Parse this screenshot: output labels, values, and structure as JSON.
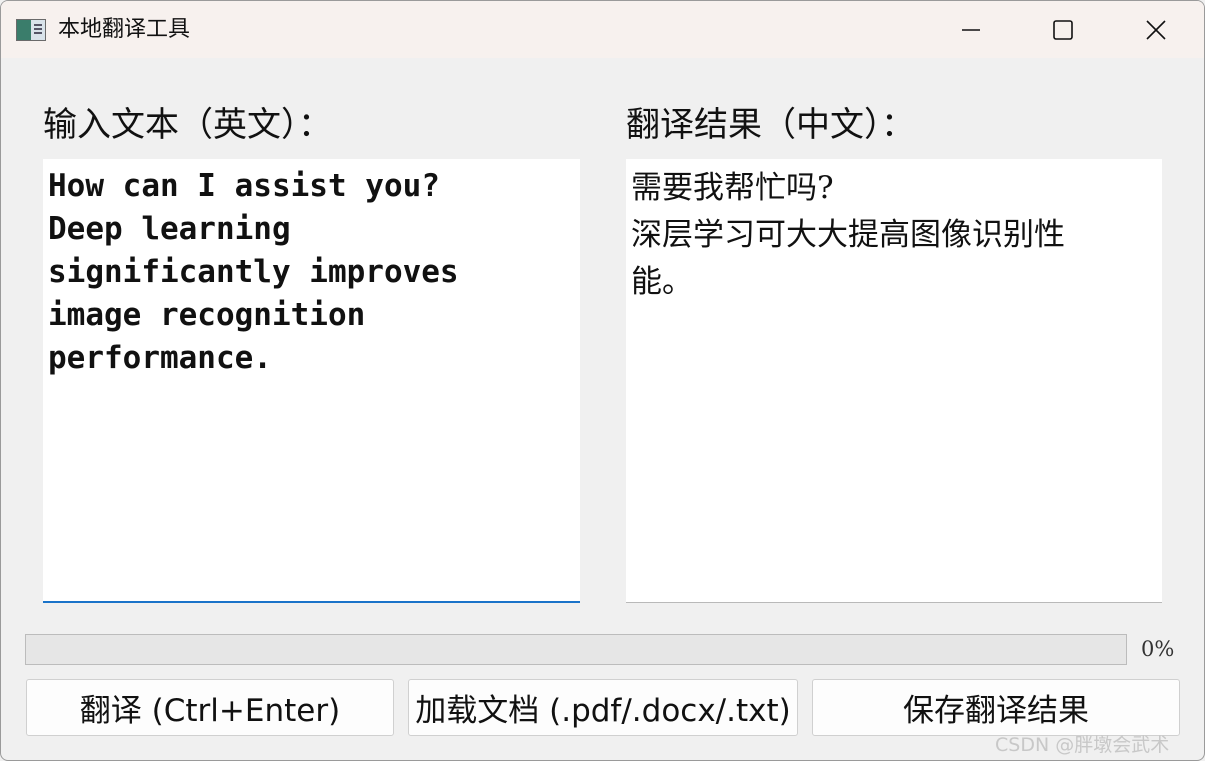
{
  "window": {
    "title": "本地翻译工具"
  },
  "labels": {
    "input": "输入文本（英文）：",
    "output": "翻译结果（中文）："
  },
  "input_lines": [
    "How can I assist you?",
    "Deep learning",
    "significantly improves",
    "image recognition",
    "performance."
  ],
  "output_lines": [
    "需要我帮忙吗?",
    "深层学习可大大提高图像识别性",
    "能。"
  ],
  "progress": {
    "value": 0,
    "text": "0%"
  },
  "buttons": {
    "translate": "翻译 (Ctrl+Enter)",
    "load": "加载文档 (.pdf/.docx/.txt)",
    "save": "保存翻译结果"
  },
  "watermark": "CSDN @胖墩会武术",
  "colors": {
    "titlebar_bg": "#f7f1ee",
    "window_bg": "#f0f0f0",
    "focus_accent": "#1a73c9"
  }
}
